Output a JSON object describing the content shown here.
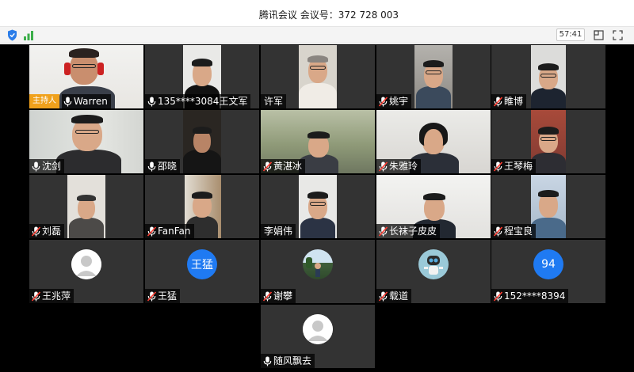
{
  "window": {
    "title": "腾讯会议  会议号：372 728 003"
  },
  "toolbar": {
    "timer": "57:41",
    "shield_icon": "shield-icon",
    "signal_icon": "signal-strength-icon",
    "layout_icon": "layout-icon",
    "fullscreen_icon": "fullscreen-icon"
  },
  "colors": {
    "grid_background": "#000000",
    "tile_background": "#333333",
    "host_badge": "#f0a11c",
    "avatar_blue": "#1f7af2",
    "muted_mic": "#ff3b30",
    "active_mic": "#ffffff"
  },
  "participants": [
    {
      "name": "Warren",
      "host_badge": "主持人",
      "mic": "on",
      "video": true
    },
    {
      "name": "135****3084王文军",
      "mic": "on",
      "video": true
    },
    {
      "name": "许军",
      "mic": "none",
      "video": true
    },
    {
      "name": "姚宇",
      "mic": "muted",
      "video": true
    },
    {
      "name": "睢博",
      "mic": "muted",
      "video": true
    },
    {
      "name": "沈剑",
      "mic": "on",
      "video": true
    },
    {
      "name": "邵晓",
      "mic": "on",
      "video": true
    },
    {
      "name": "黄湛冰",
      "mic": "muted",
      "video": true
    },
    {
      "name": "朱雅玲",
      "mic": "muted",
      "video": true
    },
    {
      "name": "王琴梅",
      "mic": "muted",
      "video": true
    },
    {
      "name": "刘磊",
      "mic": "muted",
      "video": true
    },
    {
      "name": "FanFan",
      "mic": "muted",
      "video": true
    },
    {
      "name": "李娟伟",
      "mic": "none",
      "video": true
    },
    {
      "name": "长袜子皮皮",
      "mic": "muted",
      "video": true
    },
    {
      "name": "程宝良",
      "mic": "muted",
      "video": true
    },
    {
      "name": "王兆萍",
      "mic": "muted",
      "video": false,
      "avatar": "default"
    },
    {
      "name": "王猛",
      "mic": "muted",
      "video": false,
      "avatar": "text",
      "avatar_text": "王猛"
    },
    {
      "name": "谢攀",
      "mic": "muted",
      "video": false,
      "avatar": "photo"
    },
    {
      "name": "载道",
      "mic": "muted",
      "video": false,
      "avatar": "robot"
    },
    {
      "name": "152****8394",
      "mic": "muted",
      "video": false,
      "avatar": "text",
      "avatar_text": "94"
    },
    {
      "name": "随风飘去",
      "mic": "on",
      "video": false,
      "avatar": "default"
    }
  ]
}
